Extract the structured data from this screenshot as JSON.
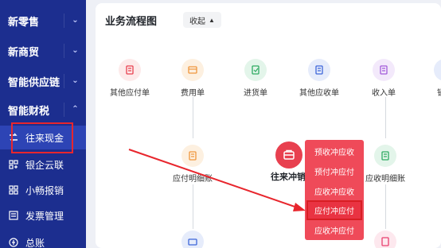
{
  "sidebar": {
    "sections": [
      {
        "label": "新零售",
        "chevron": "chevron-down"
      },
      {
        "label": "新商贸",
        "chevron": "chevron-down"
      },
      {
        "label": "智能供应链",
        "chevron": "chevron-down"
      },
      {
        "label": "智能财税",
        "chevron": "chevron-up"
      }
    ],
    "items": [
      {
        "label": "往来现金",
        "icon": "exchange-icon"
      },
      {
        "label": "银企云联",
        "icon": "bank-icon"
      },
      {
        "label": "小畅报销",
        "icon": "reimburse-icon"
      },
      {
        "label": "发票管理",
        "icon": "invoice-icon"
      },
      {
        "label": "总账",
        "icon": "ledger-icon"
      }
    ]
  },
  "main": {
    "title": "业务流程图",
    "collapse_label": "收起",
    "top_nodes": [
      {
        "label": "其他应付单"
      },
      {
        "label": "费用单"
      },
      {
        "label": "进货单"
      },
      {
        "label": "其他应收单"
      },
      {
        "label": "收入单"
      },
      {
        "label": "销"
      }
    ],
    "mid_nodes": [
      {
        "label": "应付明细账"
      },
      {
        "label": "应收明细账"
      }
    ],
    "center": {
      "label": "往来冲销"
    },
    "popup_menu": [
      {
        "label": "预收冲应收"
      },
      {
        "label": "预付冲应付"
      },
      {
        "label": "应收冲应收"
      },
      {
        "label": "应付冲应付"
      },
      {
        "label": "应收冲应付"
      }
    ]
  },
  "colors": {
    "sidebar_bg": "#1c2e8f",
    "active_item_bg": "#2d44b5",
    "accent_red": "#e8404f",
    "annotation_red": "#e8262d"
  }
}
